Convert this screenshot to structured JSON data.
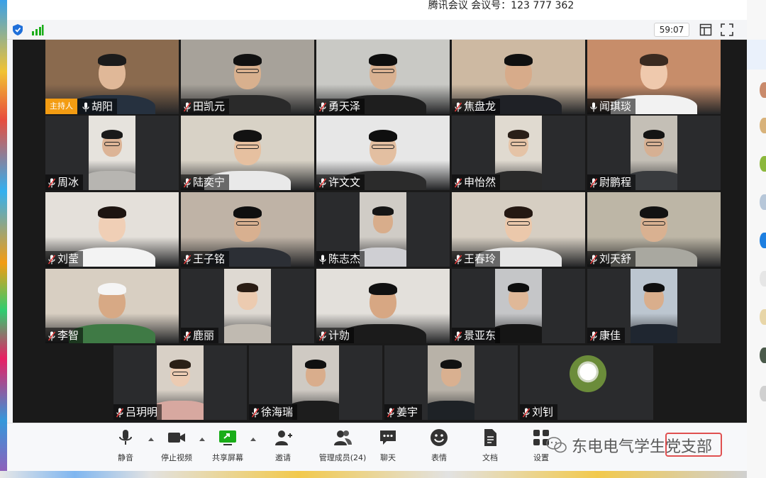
{
  "window": {
    "title": "腾讯会议 会议号：123 777 362",
    "timer": "59:07"
  },
  "icons": {
    "security": "shield-icon",
    "network": "signal-icon",
    "layout": "layout-icon",
    "fullscreen": "fullscreen-icon"
  },
  "participants": [
    {
      "name": "胡阳",
      "host_label": "主持人",
      "mic": "on"
    },
    {
      "name": "田凯元",
      "mic": "muted"
    },
    {
      "name": "勇天泽",
      "mic": "muted"
    },
    {
      "name": "焦盘龙",
      "mic": "muted"
    },
    {
      "name": "闻琪琰",
      "mic": "on"
    },
    {
      "name": "周冰",
      "mic": "muted"
    },
    {
      "name": "陆奕宁",
      "mic": "muted"
    },
    {
      "name": "许文文",
      "mic": "muted"
    },
    {
      "name": "申怡然",
      "mic": "muted"
    },
    {
      "name": "尉鹏程",
      "mic": "muted"
    },
    {
      "name": "刘莹",
      "mic": "muted"
    },
    {
      "name": "王子铭",
      "mic": "muted"
    },
    {
      "name": "陈志杰",
      "mic": "on"
    },
    {
      "name": "王春玲",
      "mic": "muted"
    },
    {
      "name": "刘天舒",
      "mic": "muted"
    },
    {
      "name": "李智",
      "mic": "muted"
    },
    {
      "name": "鹿丽",
      "mic": "muted"
    },
    {
      "name": "计勍",
      "mic": "muted"
    },
    {
      "name": "景亚东",
      "mic": "muted"
    },
    {
      "name": "康佳",
      "mic": "muted"
    },
    {
      "name": "吕玥明",
      "mic": "muted"
    },
    {
      "name": "徐海瑞",
      "mic": "muted"
    },
    {
      "name": "姜宇",
      "mic": "muted"
    },
    {
      "name": "刘钊",
      "mic": "muted"
    }
  ],
  "toolbar": {
    "mute": "静音",
    "stop_video": "停止视频",
    "share_screen": "共享屏幕",
    "invite": "邀请",
    "manage_members": "管理成员(24)",
    "chat": "聊天",
    "emoji": "表情",
    "docs": "文档",
    "settings": "设置"
  },
  "watermark": {
    "text": "东电电气学生党支部"
  },
  "colors": {
    "host_badge": "#f39c12",
    "share_green": "#1aad19",
    "stamp_red": "#e05050"
  }
}
